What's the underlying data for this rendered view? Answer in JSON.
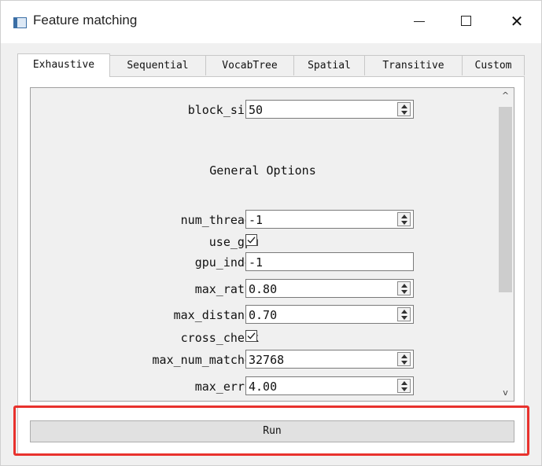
{
  "window": {
    "title": "Feature matching",
    "close_glyph": "✕"
  },
  "tabs": [
    {
      "label": "Exhaustive",
      "active": true
    },
    {
      "label": "Sequential",
      "active": false
    },
    {
      "label": "VocabTree",
      "active": false
    },
    {
      "label": "Spatial",
      "active": false
    },
    {
      "label": "Transitive",
      "active": false
    },
    {
      "label": "Custom",
      "active": false
    }
  ],
  "form": {
    "block_size": {
      "label": "block_size",
      "value": "50"
    },
    "section_title": "General Options",
    "num_threads": {
      "label": "num_threads",
      "value": "-1"
    },
    "use_gpu": {
      "label": "use_gpu",
      "checked": true
    },
    "gpu_index": {
      "label": "gpu_index",
      "value": "-1"
    },
    "max_ratio": {
      "label": "max_ratio",
      "value": "0.80"
    },
    "max_distance": {
      "label": "max_distance",
      "value": "0.70"
    },
    "cross_check": {
      "label": "cross_check",
      "checked": true
    },
    "max_num_matches": {
      "label": "max_num_matches",
      "value": "32768"
    },
    "max_error": {
      "label": "max_error",
      "value": "4.00"
    }
  },
  "scrollbar": {
    "up_glyph": "^",
    "down_glyph": "v"
  },
  "run_label": "Run",
  "colors": {
    "highlight": "#e8322d",
    "window_bg": "#f0f0f0"
  },
  "icons": [
    "app-icon",
    "minimize-icon",
    "maximize-icon",
    "close-icon",
    "check-icon",
    "spin-arrows-icon",
    "scroll-up-icon",
    "scroll-down-icon"
  ]
}
